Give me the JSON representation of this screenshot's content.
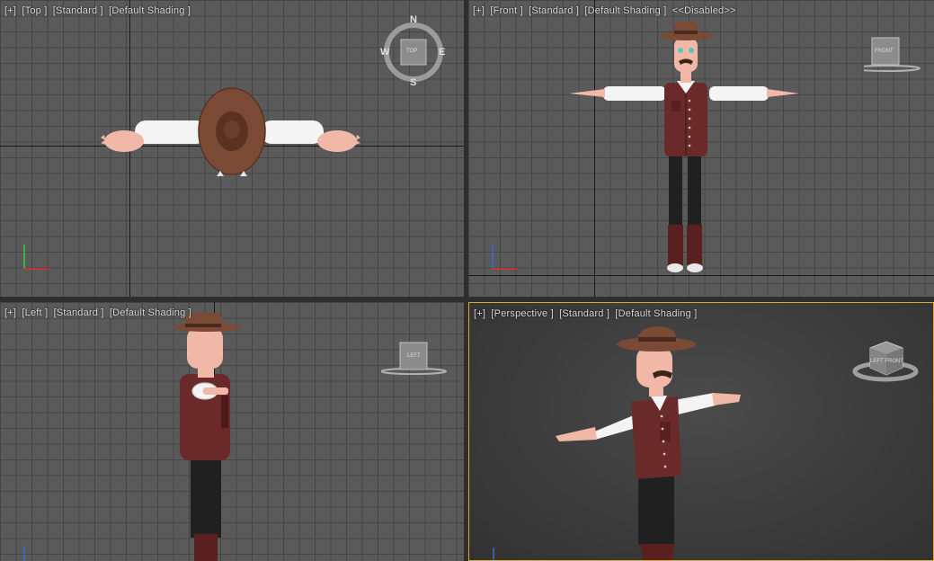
{
  "viewports": {
    "top": {
      "plus": "[+]",
      "view": "[Top ]",
      "standard": "[Standard ]",
      "shading": "[Default Shading ]",
      "compass": {
        "n": "N",
        "s": "S",
        "e": "E",
        "w": "W",
        "cube_label": "TOP"
      }
    },
    "front": {
      "plus": "[+]",
      "view": "[Front ]",
      "standard": "[Standard ]",
      "shading": "[Default Shading ]",
      "extra": "<<Disabled>>",
      "cube_label": "FRONT"
    },
    "left": {
      "plus": "[+]",
      "view": "[Left ]",
      "standard": "[Standard ]",
      "shading": "[Default Shading ]",
      "cube_label": "LEFT"
    },
    "perspective": {
      "plus": "[+]",
      "view": "[Perspective ]",
      "standard": "[Standard ]",
      "shading": "[Default Shading ]",
      "cube_label": "LEFT FRONT",
      "active": true
    }
  },
  "gizmo": {
    "x": "x",
    "y": "y",
    "z": "z"
  },
  "colors": {
    "active_border": "#d9a836",
    "vest": "#6b2a2a",
    "hat": "#7a4a35",
    "skin": "#f1b8a8",
    "sleeve": "#f4f4f4",
    "pants": "#202020",
    "boots": "#5a1f1f"
  }
}
